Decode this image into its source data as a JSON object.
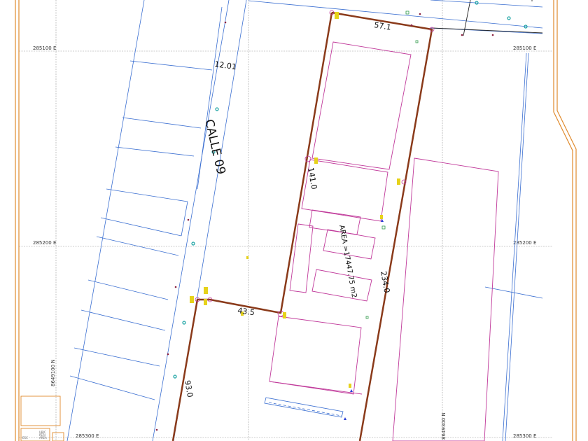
{
  "map": {
    "grid_labels": {
      "e_285100_left": "285100 E",
      "e_285100_right": "285100 E",
      "e_285200_left": "285200 E",
      "e_285200_right": "285200 E",
      "e_285300_left": "285300 E",
      "e_285300_right": "285300 E",
      "n_8649100": "8649100 N",
      "n_8649300": "8649300 N"
    },
    "street_label": "CALLE 09",
    "street_width_label": "12.01",
    "dimensions": {
      "top": "57.1",
      "left_upper": "141.0",
      "right": "234.0",
      "middle": "43.5",
      "left_lower": "93.0"
    },
    "area_label": "AREA =17447.75 m2",
    "legend_text": [
      "UBIC",
      "PERI",
      "AREA",
      "ESC"
    ],
    "colors": {
      "boundary": "#8a3a1a",
      "lots": "#3b6fd1",
      "buildings": "#c0399a",
      "frame": "#e08a2c",
      "grid": "#999999",
      "points": "#1aa3a3",
      "markers": "#e6d21a"
    }
  }
}
